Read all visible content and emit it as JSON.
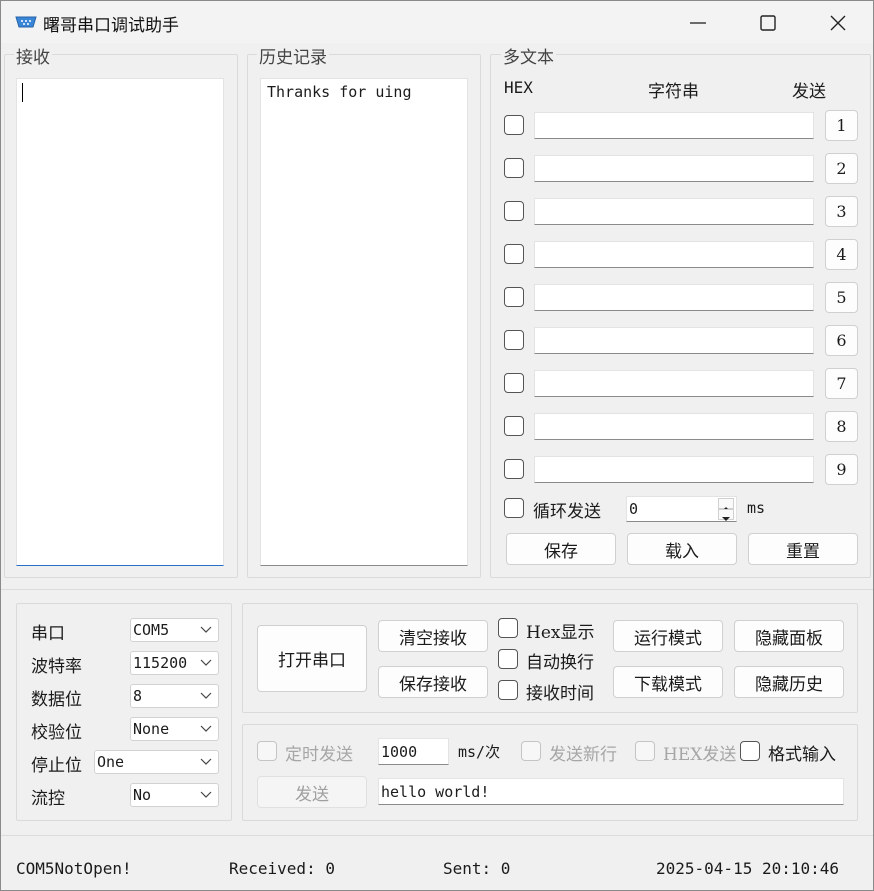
{
  "window": {
    "title": "曙哥串口调试助手"
  },
  "receive": {
    "group_label": "接收",
    "text": ""
  },
  "history": {
    "group_label": "历史记录",
    "text": "Thranks for uing"
  },
  "multitext": {
    "group_label": "多文本",
    "col_hex": "HEX",
    "col_string": "字符串",
    "col_send": "发送",
    "rows": [
      {
        "hex": false,
        "value": "",
        "button": "1"
      },
      {
        "hex": false,
        "value": "",
        "button": "2"
      },
      {
        "hex": false,
        "value": "",
        "button": "3"
      },
      {
        "hex": false,
        "value": "",
        "button": "4"
      },
      {
        "hex": false,
        "value": "",
        "button": "5"
      },
      {
        "hex": false,
        "value": "",
        "button": "6"
      },
      {
        "hex": false,
        "value": "",
        "button": "7"
      },
      {
        "hex": false,
        "value": "",
        "button": "8"
      },
      {
        "hex": false,
        "value": "",
        "button": "9"
      }
    ],
    "loop_send_label": "循环发送",
    "loop_interval": "0",
    "loop_unit": "ms",
    "save_label": "保存",
    "load_label": "载入",
    "reset_label": "重置"
  },
  "serial_config": {
    "port_label": "串口",
    "port_value": "COM5",
    "baud_label": "波特率",
    "baud_value": "115200",
    "databits_label": "数据位",
    "databits_value": "8",
    "parity_label": "校验位",
    "parity_value": "None",
    "stopbits_label": "停止位",
    "stopbits_value": "One",
    "flow_label": "流控",
    "flow_value": "No"
  },
  "controls": {
    "open_port": "打开串口",
    "clear_receive": "清空接收",
    "save_receive": "保存接收",
    "hex_display": "Hex显示",
    "auto_newline": "自动换行",
    "receive_time": "接收时间",
    "run_mode": "运行模式",
    "download_mode": "下载模式",
    "hide_panel": "隐藏面板",
    "hide_history": "隐藏历史"
  },
  "send": {
    "timed_send_label": "定时发送",
    "interval_value": "1000",
    "interval_unit": "ms/次",
    "send_newline_label": "发送新行",
    "hex_send_label": "HEX发送",
    "format_input_label": "格式输入",
    "send_button": "发送",
    "send_text": "hello world!"
  },
  "statusbar": {
    "port_status": "COM5NotOpen!",
    "received": "Received: 0",
    "sent": "Sent: 0",
    "datetime": "2025-04-15 20:10:46"
  }
}
